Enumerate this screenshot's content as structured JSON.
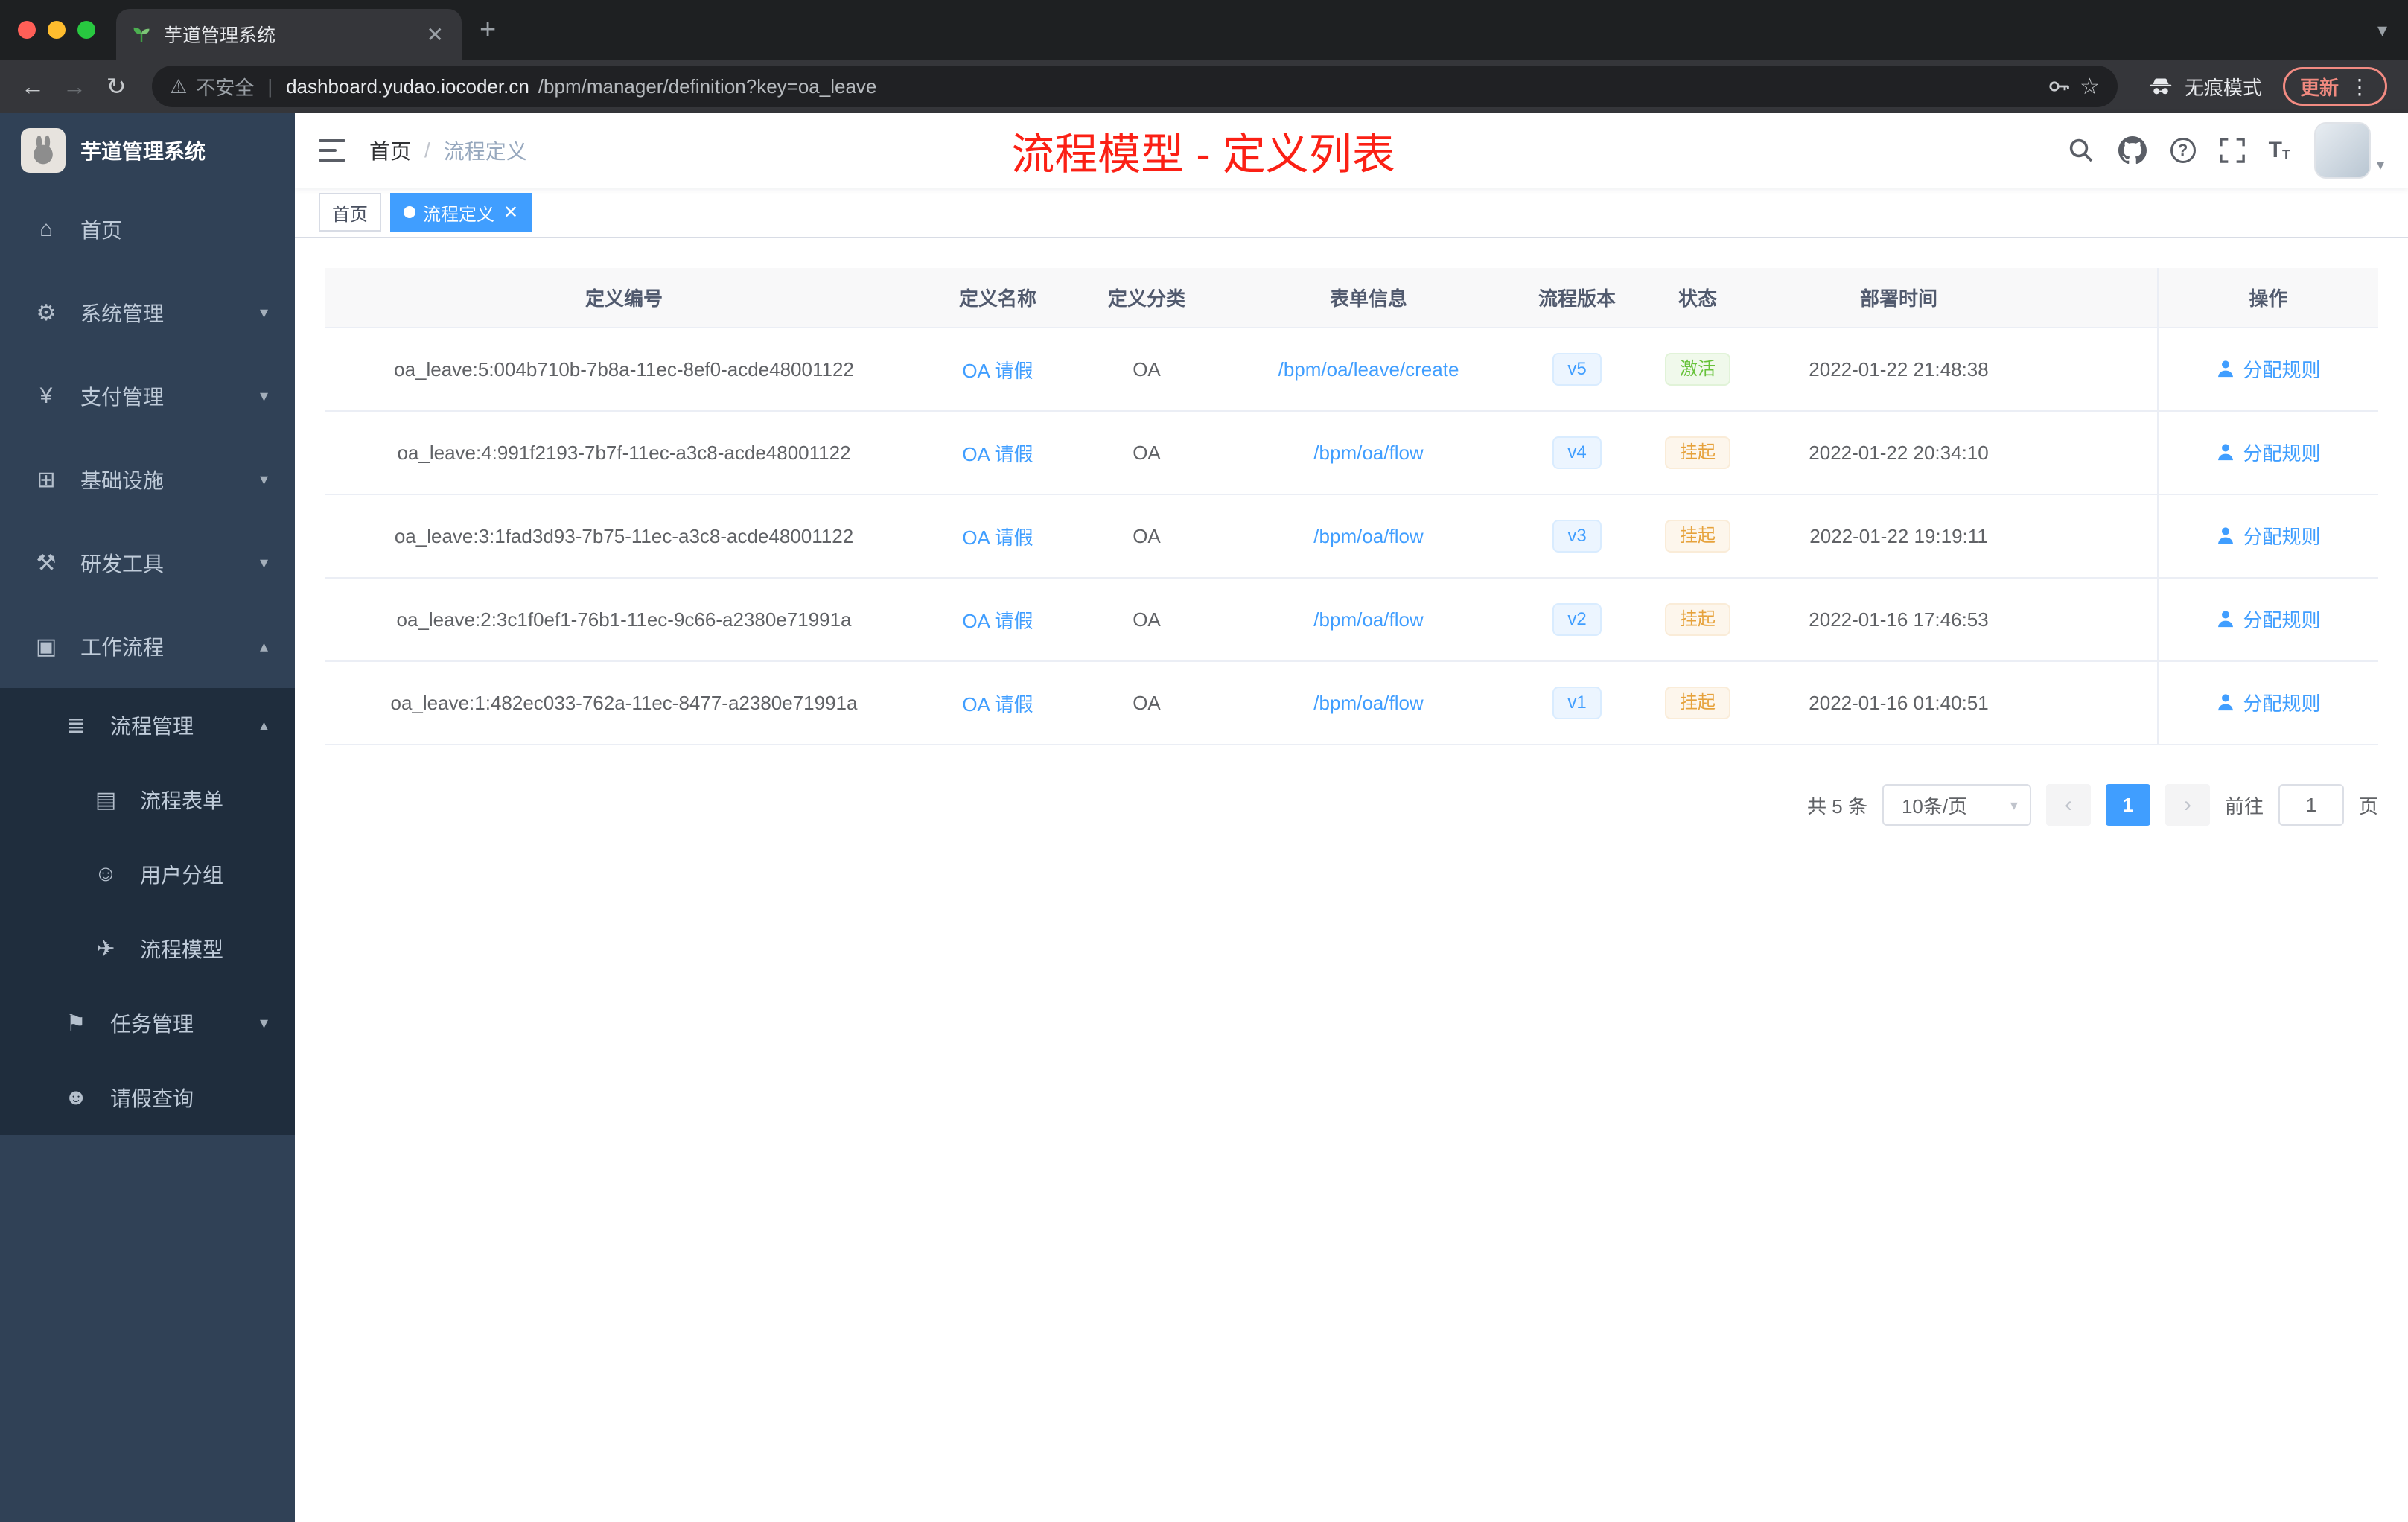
{
  "colors": {
    "accent": "#409eff",
    "success": "#67c23a",
    "warning": "#e6a23c",
    "annotation_red": "#fb2015",
    "sidebar_bg": "#304156",
    "submenu_bg": "#1f2d3d"
  },
  "browser": {
    "tab_title": "芋道管理系统",
    "security_label": "不安全",
    "url_host": "dashboard.yudao.iocoder.cn",
    "url_path": "/bpm/manager/definition?key=oa_leave",
    "incognito_label": "无痕模式",
    "update_label": "更新"
  },
  "sidebar": {
    "logo_title": "芋道管理系统",
    "menu": [
      {
        "label": "首页",
        "glyph": "⌂"
      },
      {
        "label": "系统管理",
        "glyph": "⚙"
      },
      {
        "label": "支付管理",
        "glyph": "¥"
      },
      {
        "label": "基础设施",
        "glyph": "⊞"
      },
      {
        "label": "研发工具",
        "glyph": "⚒"
      },
      {
        "label": "工作流程",
        "glyph": "▣"
      }
    ],
    "submenu": {
      "process_mgmt": {
        "label": "流程管理",
        "glyph": "≣"
      },
      "process_form": {
        "label": "流程表单",
        "glyph": "▤"
      },
      "user_group": {
        "label": "用户分组",
        "glyph": "☺"
      },
      "process_model": {
        "label": "流程模型",
        "glyph": "✈"
      },
      "task_mgmt": {
        "label": "任务管理",
        "glyph": "⚑"
      },
      "leave_query": {
        "label": "请假查询",
        "glyph": "☻"
      }
    }
  },
  "header": {
    "breadcrumb_home": "首页",
    "breadcrumb_sep": "/",
    "breadcrumb_current": "流程定义",
    "annotation_title": "流程模型 - 定义列表"
  },
  "tags": {
    "home": "首页",
    "current": "流程定义"
  },
  "table": {
    "columns": [
      "定义编号",
      "定义名称",
      "定义分类",
      "表单信息",
      "流程版本",
      "状态",
      "部署时间",
      "操作"
    ],
    "action_label": "分配规则",
    "rows": [
      {
        "id": "oa_leave:5:004b710b-7b8a-11ec-8ef0-acde48001122",
        "name": "OA 请假",
        "category": "OA",
        "form": "/bpm/oa/leave/create",
        "version": "v5",
        "status": "激活",
        "status_type": "success",
        "time": "2022-01-22 21:48:38"
      },
      {
        "id": "oa_leave:4:991f2193-7b7f-11ec-a3c8-acde48001122",
        "name": "OA 请假",
        "category": "OA",
        "form": "/bpm/oa/flow",
        "version": "v4",
        "status": "挂起",
        "status_type": "warning",
        "time": "2022-01-22 20:34:10"
      },
      {
        "id": "oa_leave:3:1fad3d93-7b75-11ec-a3c8-acde48001122",
        "name": "OA 请假",
        "category": "OA",
        "form": "/bpm/oa/flow",
        "version": "v3",
        "status": "挂起",
        "status_type": "warning",
        "time": "2022-01-22 19:19:11"
      },
      {
        "id": "oa_leave:2:3c1f0ef1-76b1-11ec-9c66-a2380e71991a",
        "name": "OA 请假",
        "category": "OA",
        "form": "/bpm/oa/flow",
        "version": "v2",
        "status": "挂起",
        "status_type": "warning",
        "time": "2022-01-16 17:46:53"
      },
      {
        "id": "oa_leave:1:482ec033-762a-11ec-8477-a2380e71991a",
        "name": "OA 请假",
        "category": "OA",
        "form": "/bpm/oa/flow",
        "version": "v1",
        "status": "挂起",
        "status_type": "warning",
        "time": "2022-01-16 01:40:51"
      }
    ]
  },
  "pagination": {
    "total_text": "共 5 条",
    "page_size_text": "10条/页",
    "current_page": "1",
    "goto_label": "前往",
    "goto_value": "1",
    "goto_unit": "页"
  }
}
